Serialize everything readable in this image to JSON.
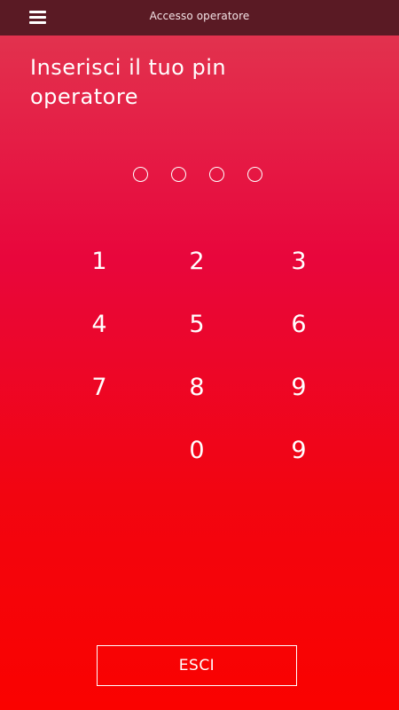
{
  "header": {
    "title": "Accesso operatore",
    "menu_icon": "hamburger-menu-icon"
  },
  "prompt": {
    "line1": "Inserisci il tuo pin",
    "line2": "operatore"
  },
  "pin": {
    "length": 4,
    "filled": 0
  },
  "keypad": {
    "keys": [
      "1",
      "2",
      "3",
      "4",
      "5",
      "6",
      "7",
      "8",
      "9",
      "0",
      "9"
    ]
  },
  "footer": {
    "exit_label": "ESCI"
  },
  "colors": {
    "header_bg": "#5a1a24",
    "gradient_top": "#e2324e",
    "gradient_bottom": "#fa0200",
    "text": "#ffffff"
  }
}
